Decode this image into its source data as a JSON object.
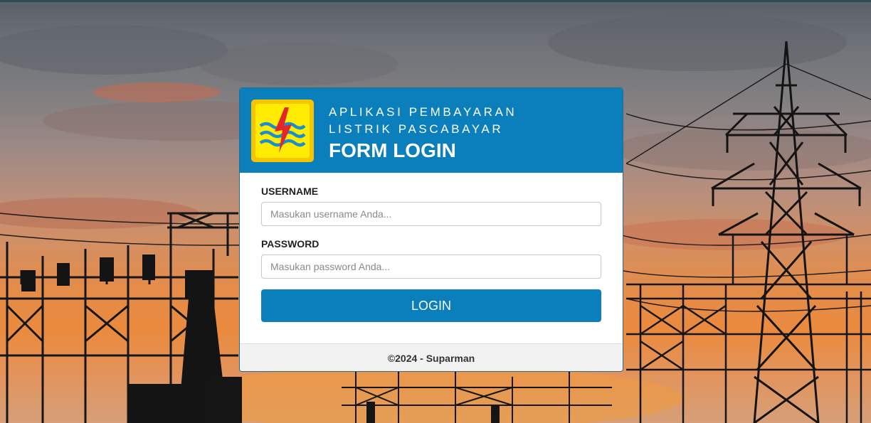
{
  "header": {
    "app_title_line1": "APLIKASI PEMBAYARAN",
    "app_title_line2": "LISTRIK PASCABAYAR",
    "form_title": "FORM LOGIN"
  },
  "form": {
    "username_label": "USERNAME",
    "username_placeholder": "Masukan username Anda...",
    "username_value": "",
    "password_label": "PASSWORD",
    "password_placeholder": "Masukan password Anda...",
    "password_value": "",
    "submit_label": "LOGIN"
  },
  "footer": {
    "copyright": "©2024 - Suparman"
  },
  "colors": {
    "primary": "#0a7fbc",
    "logo_yellow": "#ffec00",
    "logo_red": "#e3262b",
    "logo_blue": "#0a7fbc"
  },
  "icons": {
    "logo": "pln-lightning-waves-logo"
  }
}
